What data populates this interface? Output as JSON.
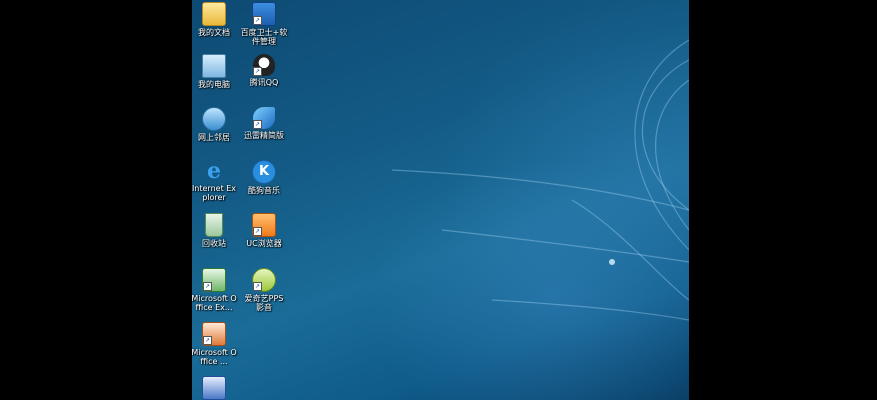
{
  "desktop": {
    "icons": [
      {
        "label": "我的文档"
      },
      {
        "label": "百度卫士+软件管理"
      },
      {
        "label": "我的电脑"
      },
      {
        "label": "腾讯QQ"
      },
      {
        "label": "网上邻居"
      },
      {
        "label": "迅雷精简版"
      },
      {
        "label": "Internet Explorer"
      },
      {
        "label": "酷狗音乐"
      },
      {
        "label": "回收站"
      },
      {
        "label": "UC浏览器"
      },
      {
        "label": "Microsoft Office Ex..."
      },
      {
        "label": "爱奇艺PPS 影音"
      },
      {
        "label": "Microsoft Office ..."
      },
      {
        "label": ""
      }
    ]
  }
}
